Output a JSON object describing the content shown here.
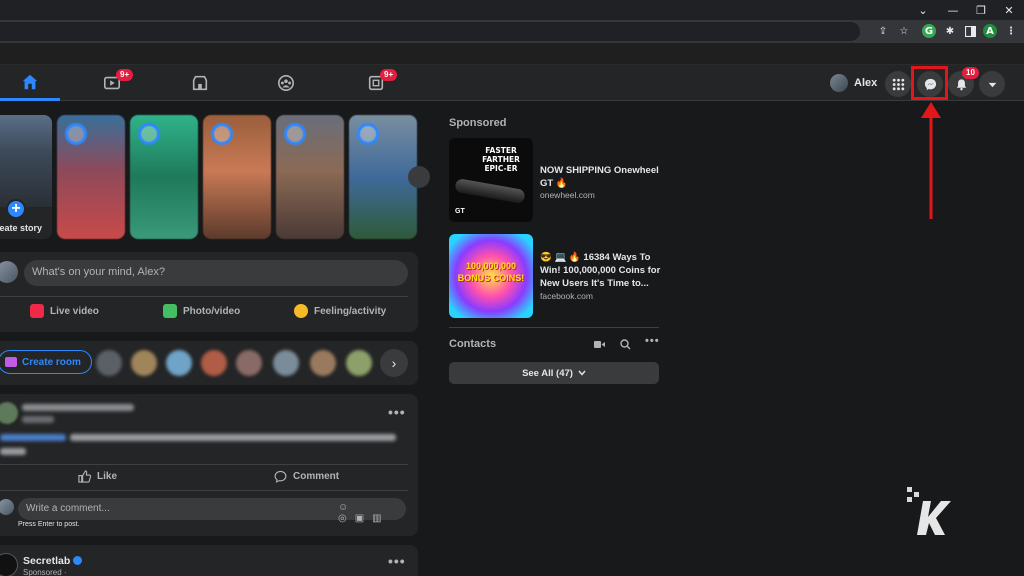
{
  "browser": {
    "window_controls": [
      "⌄",
      "—",
      "❐",
      "✕"
    ],
    "profile_initial": "A"
  },
  "nav": {
    "watch_badge": "9+",
    "gaming_badge": "9+",
    "profile_name": "Alex",
    "notifications_badge": "10"
  },
  "stories": {
    "create_label": "reate story"
  },
  "composer": {
    "placeholder": "What's on your mind, Alex?",
    "live_video": "Live video",
    "photo_video": "Photo/video",
    "feeling_activity": "Feeling/activity"
  },
  "rooms": {
    "create_room": "Create room"
  },
  "post": {
    "like": "Like",
    "comment": "Comment",
    "comment_placeholder": "Write a comment...",
    "hint": "Press Enter to post."
  },
  "post2": {
    "author": "Secretlab",
    "meta": "Sponsored · "
  },
  "right": {
    "sponsored": "Sponsored",
    "ads": [
      {
        "title": "NOW SHIPPING Onewheel GT 🔥",
        "domain": "onewheel.com",
        "image_text": "FASTER FARTHER EPIC-ER",
        "image_badge": "GT"
      },
      {
        "title": "😎 💻 🔥 16384 Ways To Win! 100,000,000 Coins for New Users It's Time to...",
        "domain": "facebook.com",
        "image_text": "100,000,000 BONUS COINS!"
      }
    ],
    "contacts": "Contacts",
    "see_all": "See All (47)"
  },
  "colors": {
    "accent": "#2d88ff",
    "highlight": "#e3161b",
    "badge": "#e41e3f"
  }
}
